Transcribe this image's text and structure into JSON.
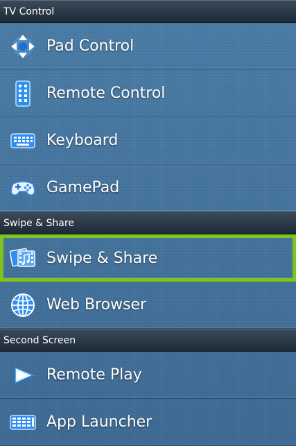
{
  "sections": [
    {
      "header": "TV Control",
      "items": [
        {
          "label": "Pad Control",
          "icon": "pad-control-icon"
        },
        {
          "label": "Remote Control",
          "icon": "remote-control-icon"
        },
        {
          "label": "Keyboard",
          "icon": "keyboard-icon"
        },
        {
          "label": "GamePad",
          "icon": "gamepad-icon"
        }
      ]
    },
    {
      "header": "Swipe & Share",
      "items": [
        {
          "label": "Swipe & Share",
          "icon": "swipe-share-icon",
          "selected": true
        },
        {
          "label": "Web Browser",
          "icon": "globe-icon"
        }
      ]
    },
    {
      "header": "Second Screen",
      "items": [
        {
          "label": "Remote Play",
          "icon": "remote-play-icon"
        },
        {
          "label": "App Launcher",
          "icon": "app-launcher-icon"
        }
      ]
    }
  ],
  "colors": {
    "selection_border": "#7fc31c",
    "background": "#3f6f98",
    "icon_blue": "#2f8ff0"
  }
}
